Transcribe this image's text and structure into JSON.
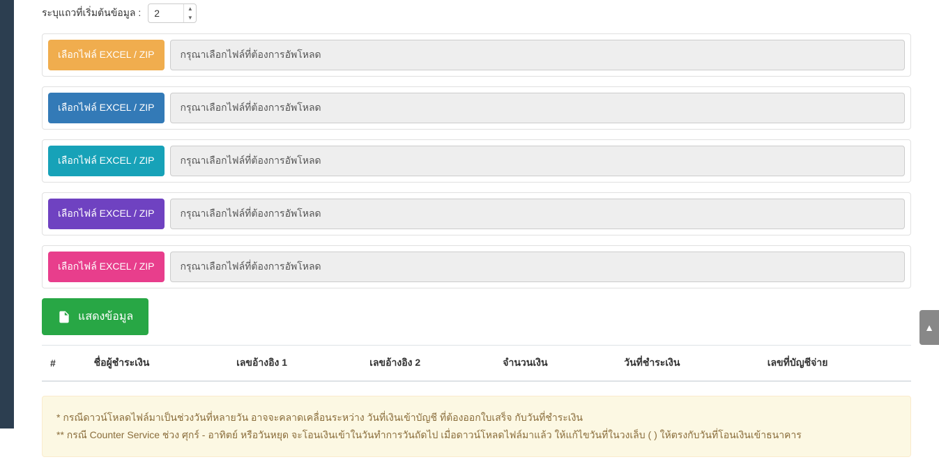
{
  "start_row": {
    "label": "ระบุแถวที่เริ่มต้นข้อมูล :",
    "value": "2"
  },
  "file_buttons": {
    "label": "เลือกไฟล์ EXCEL / ZIP"
  },
  "file_placeholder": "กรุณาเลือกไฟล์ที่ต้องการอัพโหลด",
  "submit_label": "แสดงข้อมูล",
  "table": {
    "headers": {
      "num": "#",
      "payer": "ชื่อผู้ชำระเงิน",
      "ref1": "เลขอ้างอิง 1",
      "ref2": "เลขอ้างอิง 2",
      "amount": "จำนวนเงิน",
      "pay_date": "วันที่ชำระเงิน",
      "account": "เลขที่บัญชีจ่าย"
    }
  },
  "alert": {
    "line1": "* กรณีดาวน์โหลดไฟล์มาเป็นช่วงวันที่หลายวัน อาจจะคลาดเคลื่อนระหว่าง วันที่เงินเข้าบัญชี ที่ต้องออกใบเสร็จ กับวันที่ชำระเงิน",
    "line2": "** กรณี Counter Service ช่วง ศุกร์ - อาทิตย์ หรือวันหยุด จะโอนเงินเข้าในวันทำการวันถัดไป เมื่อดาวน์โหลดไฟล์มาแล้ว ให้แก้ไขวันที่ในวงเล็บ ( ) ให้ตรงกับวันที่โอนเงินเข้าธนาคาร"
  },
  "scroll_top_icon": "▲"
}
